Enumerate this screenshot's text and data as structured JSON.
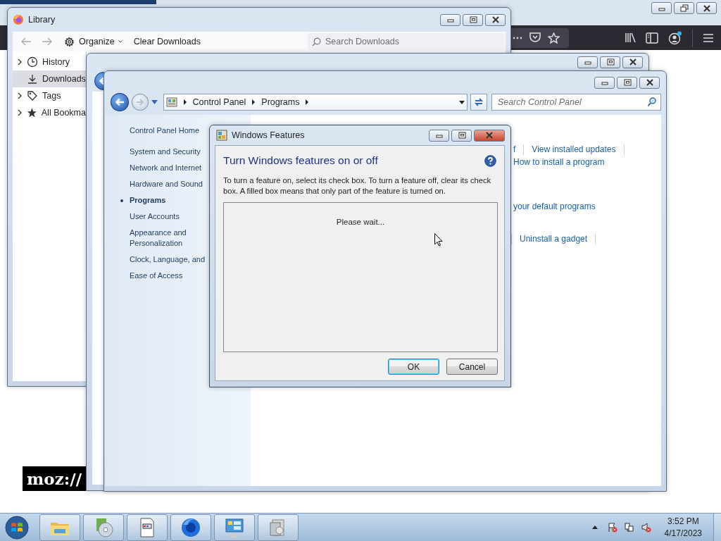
{
  "browser_window": {
    "logo": "moz://"
  },
  "library_window": {
    "title": "Library",
    "toolbar": {
      "organize": "Organize",
      "clear": "Clear Downloads",
      "search": {
        "placeholder": "Search Downloads"
      }
    },
    "sidebar": [
      {
        "kind": "history",
        "label": "History",
        "expandable": true,
        "selected": false
      },
      {
        "kind": "downloads",
        "label": "Downloads",
        "expandable": false,
        "selected": true
      },
      {
        "kind": "tags",
        "label": "Tags",
        "expandable": true,
        "selected": false
      },
      {
        "kind": "bookmarks",
        "label": "All Bookma",
        "expandable": true,
        "selected": false
      }
    ]
  },
  "control_panel": {
    "breadcrumb": [
      "Control Panel",
      "Programs"
    ],
    "search": {
      "placeholder": "Search Control Panel"
    },
    "home": "Control Panel Home",
    "nav": [
      {
        "label": "System and Security",
        "selected": false
      },
      {
        "label": "Network and Internet",
        "selected": false
      },
      {
        "label": "Hardware and Sound",
        "selected": false
      },
      {
        "label": "Programs",
        "selected": true
      },
      {
        "label": "User Accounts",
        "selected": false
      },
      {
        "label": "Appearance and Personalization",
        "selected": false
      },
      {
        "label": "Clock, Language, and",
        "selected": false
      },
      {
        "label": "Ease of Access",
        "selected": false
      }
    ],
    "link_rows": [
      {
        "links": [
          "f",
          "View installed updates"
        ],
        "leading_separator": false,
        "trailing_separator": true
      },
      {
        "links": [
          "How to install a program"
        ],
        "leading_separator": false,
        "trailing_separator": false
      },
      {
        "links": [
          "your default programs"
        ],
        "leading_separator": false,
        "trailing_separator": false
      },
      {
        "links": [
          "Uninstall a gadget"
        ],
        "leading_separator": true,
        "trailing_separator": true
      }
    ]
  },
  "dialog": {
    "title": "Windows Features",
    "heading": "Turn Windows features on or off",
    "description": "To turn a feature on, select its check box. To turn a feature off, clear its check box. A filled box means that only part of the feature is turned on.",
    "status": "Please wait...",
    "buttons": [
      {
        "label": "OK",
        "default": true
      },
      {
        "label": "Cancel",
        "default": false
      }
    ]
  },
  "taskbar": {
    "buttons": [
      {
        "kind": "folder"
      },
      {
        "kind": "media"
      },
      {
        "kind": "document"
      },
      {
        "kind": "firefox"
      },
      {
        "kind": "control-panel"
      },
      {
        "kind": "installer"
      }
    ],
    "tray": [
      {
        "kind": "show-hidden"
      },
      {
        "kind": "action-center"
      },
      {
        "kind": "network"
      },
      {
        "kind": "volume"
      }
    ],
    "time": "3:52 PM",
    "date": "4/17/2023"
  }
}
